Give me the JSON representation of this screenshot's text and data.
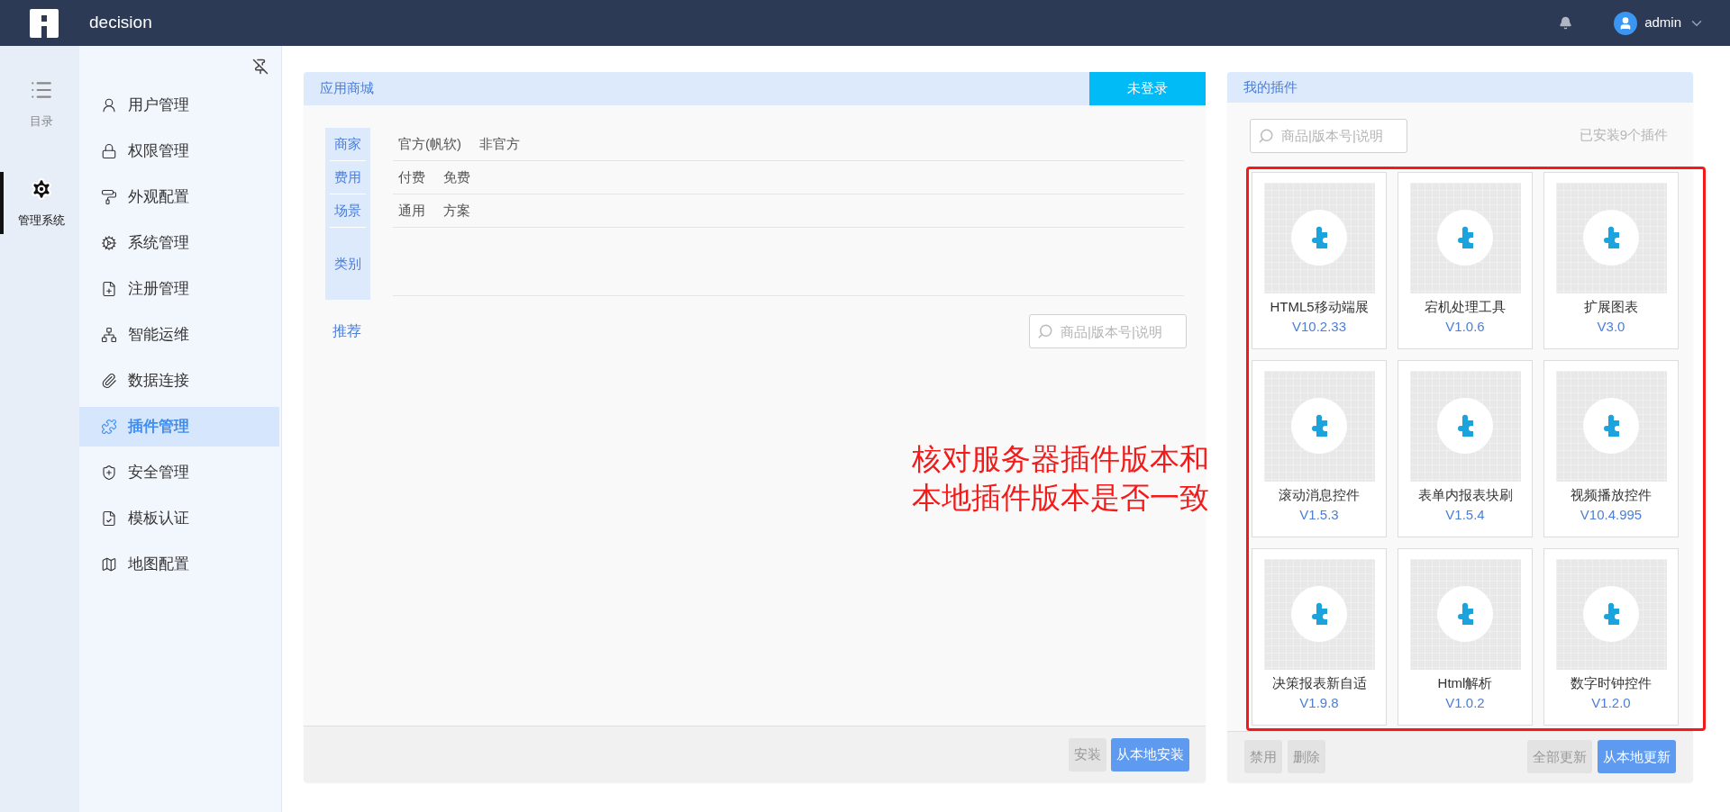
{
  "header": {
    "app_name": "decision",
    "user": "admin"
  },
  "rail": [
    {
      "label": "目录",
      "selected": false
    },
    {
      "label": "管理系统",
      "selected": true
    }
  ],
  "menu": [
    {
      "label": "用户管理",
      "selected": false
    },
    {
      "label": "权限管理",
      "selected": false
    },
    {
      "label": "外观配置",
      "selected": false
    },
    {
      "label": "系统管理",
      "selected": false
    },
    {
      "label": "注册管理",
      "selected": false
    },
    {
      "label": "智能运维",
      "selected": false
    },
    {
      "label": "数据连接",
      "selected": false
    },
    {
      "label": "插件管理",
      "selected": true
    },
    {
      "label": "安全管理",
      "selected": false
    },
    {
      "label": "模板认证",
      "selected": false
    },
    {
      "label": "地图配置",
      "selected": false
    }
  ],
  "store": {
    "title": "应用商城",
    "login_button": "未登录",
    "filters": [
      {
        "label": "商家",
        "options": [
          "官方(帆软)",
          "非官方"
        ]
      },
      {
        "label": "费用",
        "options": [
          "付费",
          "免费"
        ]
      },
      {
        "label": "场景",
        "options": [
          "通用",
          "方案"
        ]
      },
      {
        "label": "类别"
      }
    ],
    "recommend": "推荐",
    "search_placeholder": "商品|版本号|说明",
    "buttons": [
      {
        "label": "安装",
        "primary": false
      },
      {
        "label": "从本地安装",
        "primary": true
      }
    ]
  },
  "plugins_panel": {
    "title": "我的插件",
    "search_placeholder": "商品|版本号|说明",
    "count": "已安装9个插件",
    "plugins": [
      {
        "name": "HTML5移动端展",
        "version": "V10.2.33"
      },
      {
        "name": "宕机处理工具",
        "version": "V1.0.6"
      },
      {
        "name": "扩展图表",
        "version": "V3.0"
      },
      {
        "name": "滚动消息控件",
        "version": "V1.5.3"
      },
      {
        "name": "表单内报表块刷",
        "version": "V1.5.4"
      },
      {
        "name": "视频播放控件",
        "version": "V10.4.995"
      },
      {
        "name": "决策报表新自适",
        "version": "V1.9.8"
      },
      {
        "name": "Html解析",
        "version": "V1.0.2"
      },
      {
        "name": "数字时钟控件",
        "version": "V1.2.0"
      }
    ],
    "left_buttons": [
      {
        "label": "禁用",
        "primary": false
      },
      {
        "label": "删除",
        "primary": false
      }
    ],
    "right_buttons": [
      {
        "label": "全部更新",
        "primary": false
      },
      {
        "label": "从本地更新",
        "primary": true
      }
    ]
  },
  "annotation": {
    "lines": [
      "核对服务器插件版本和",
      "本地插件版本是否一致"
    ]
  }
}
